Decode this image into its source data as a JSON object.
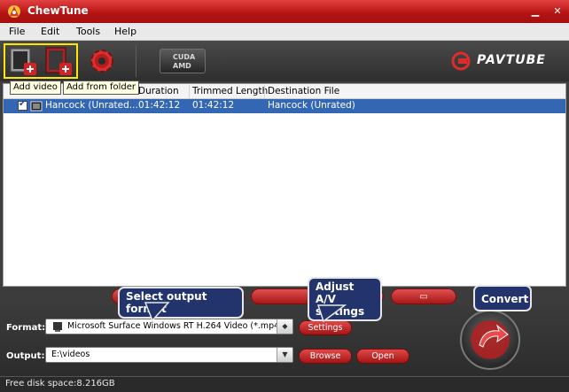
{
  "window": {
    "title": "ChewTune"
  },
  "menu": [
    "File",
    "Edit",
    "Tools",
    "Help"
  ],
  "toolbar": {
    "tooltip_add_video": "Add video",
    "tooltip_add_folder": "Add from folder",
    "gpu_badge_top": "CUDA",
    "gpu_badge_bottom": "AMD",
    "brand": "PAVTUBE"
  },
  "file_list": {
    "columns": [
      "Duration",
      "Trimmed Length",
      "Destination File"
    ],
    "rows": [
      {
        "checked": true,
        "name": "Hancock (Unrated...",
        "duration": "01:42:12",
        "trimmed": "01:42:12",
        "destination": "Hancock (Unrated)"
      }
    ]
  },
  "output": {
    "format_label": "Format:",
    "format_value": "Microsoft Surface Windows RT H.264 Video (*.mp4)",
    "settings_button": "Settings",
    "output_label": "Output:",
    "output_value": "E:\\videos",
    "browse_button": "Browse",
    "open_button": "Open"
  },
  "callouts": {
    "select_format": "Select output format",
    "adjust_av_line1": "Adjust A/V",
    "adjust_av_line2": "settings",
    "convert": "Convert"
  },
  "status": {
    "free_disk_space": "Free disk space:8.216GB"
  },
  "colors": {
    "accent": "#c41e1e",
    "selection": "#3366b3",
    "callout": "#22346b"
  }
}
